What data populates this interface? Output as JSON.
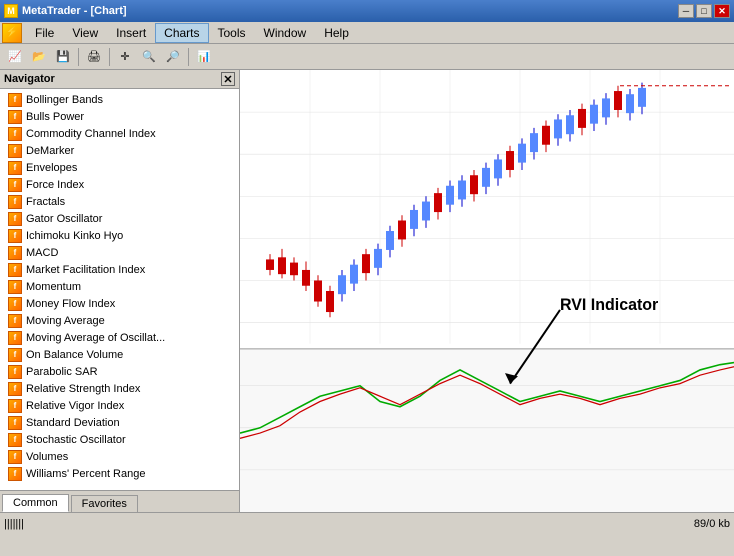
{
  "titleBar": {
    "title": "MetaTrader - [Chart]",
    "icon": "MT",
    "buttons": [
      "─",
      "□",
      "✕"
    ]
  },
  "menuBar": {
    "items": [
      "File",
      "View",
      "Insert",
      "Charts",
      "Tools",
      "Window",
      "Help"
    ],
    "activeItem": "Charts"
  },
  "navigator": {
    "title": "Navigator",
    "indicators": [
      "Bollinger Bands",
      "Bulls Power",
      "Commodity Channel Index",
      "DeMarker",
      "Envelopes",
      "Force Index",
      "Fractals",
      "Gator Oscillator",
      "Ichimoku Kinko Hyo",
      "MACD",
      "Market Facilitation Index",
      "Momentum",
      "Money Flow Index",
      "Moving Average",
      "Moving Average of Oscillat...",
      "On Balance Volume",
      "Parabolic SAR",
      "Relative Strength Index",
      "Relative Vigor Index",
      "Standard Deviation",
      "Stochastic Oscillator",
      "Volumes",
      "Williams' Percent Range"
    ],
    "tabs": [
      "Common",
      "Favorites"
    ],
    "activeTab": "Common"
  },
  "chart": {
    "label": "RVI Indicator",
    "statusLeft": "|||||||",
    "statusRight": "89/0 kb"
  }
}
